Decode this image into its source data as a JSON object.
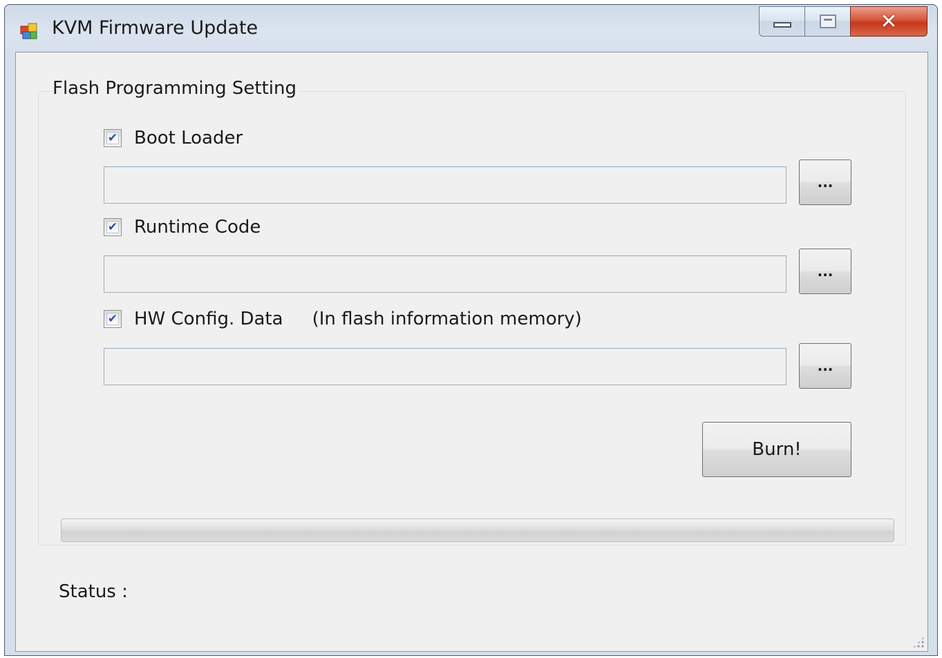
{
  "window": {
    "title": "KVM Firmware Update",
    "icon": "app-window-icon",
    "controls": {
      "minimize": "minimize-icon",
      "maximize": "maximize-icon",
      "close": "close-icon"
    }
  },
  "flash_group": {
    "legend": "Flash Programming Setting",
    "items": [
      {
        "label": "Boot Loader",
        "checked": true,
        "path": "",
        "browse_label": "..."
      },
      {
        "label": "Runtime Code",
        "checked": true,
        "path": "",
        "browse_label": "..."
      },
      {
        "label": "HW Config. Data",
        "checked": true,
        "note": "(In flash information memory)",
        "path": "",
        "browse_label": "..."
      }
    ],
    "burn_label": "Burn!",
    "progress": 0
  },
  "status": {
    "label": "Status :"
  },
  "colors": {
    "checkmark": "#3a4c9a",
    "close_button": "#c5381c",
    "client_background": "#f0f0f0"
  }
}
